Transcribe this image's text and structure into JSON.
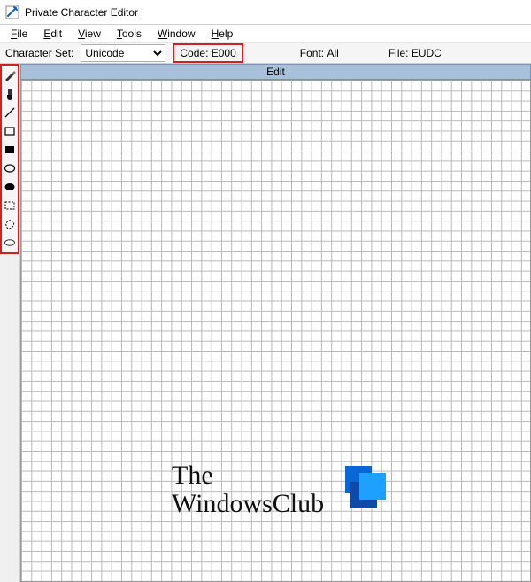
{
  "window": {
    "title": "Private Character Editor"
  },
  "menu": {
    "file": "File",
    "edit": "Edit",
    "view": "View",
    "tools": "Tools",
    "window": "Window",
    "help": "Help"
  },
  "infobar": {
    "charset_label": "Character Set:",
    "charset_value": "Unicode",
    "code_label": "Code:",
    "code_value": "E000",
    "font_label": "Font:",
    "font_value": "All",
    "file_label": "File:",
    "file_value": "EUDC"
  },
  "canvas": {
    "title": "Edit"
  },
  "tools": {
    "pencil": "pencil",
    "brush": "brush",
    "line": "line",
    "rect_outline": "rectangle-outline",
    "rect_filled": "rectangle-filled",
    "ellipse_outline": "ellipse-outline",
    "ellipse_filled": "ellipse-filled",
    "select_rect": "rectangular-select",
    "select_free": "freeform-select",
    "eraser": "eraser"
  },
  "watermark": {
    "line1": "The",
    "line2": "WindowsClub"
  }
}
